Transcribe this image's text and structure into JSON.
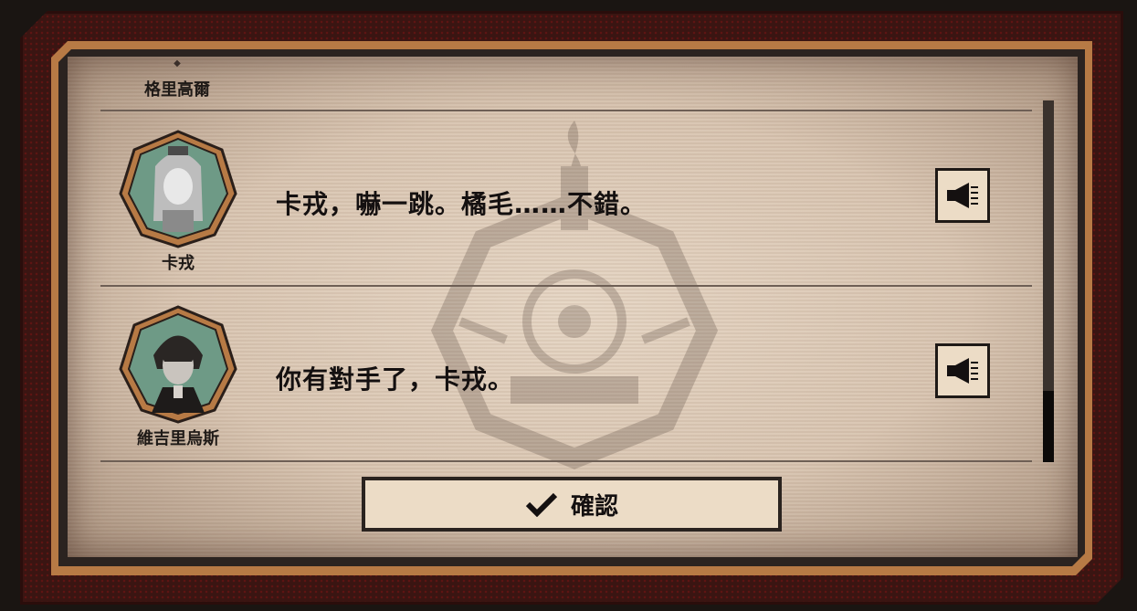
{
  "top_entry": {
    "name": "格里高爾"
  },
  "log_entries": [
    {
      "name": "卡戎",
      "line": "卡戎，嚇一跳。橘毛……不錯。",
      "voice_icon": "speaker-icon"
    },
    {
      "name": "維吉里烏斯",
      "line": "你有對手了，卡戎。",
      "voice_icon": "speaker-icon"
    }
  ],
  "confirm": {
    "label": "確認",
    "icon": "checkmark-icon"
  },
  "colors": {
    "frame_red": "#3a1512",
    "frame_copper": "#b77a45",
    "avatar_teal": "#6e9a86",
    "panel_paper": "#e0cebb"
  }
}
